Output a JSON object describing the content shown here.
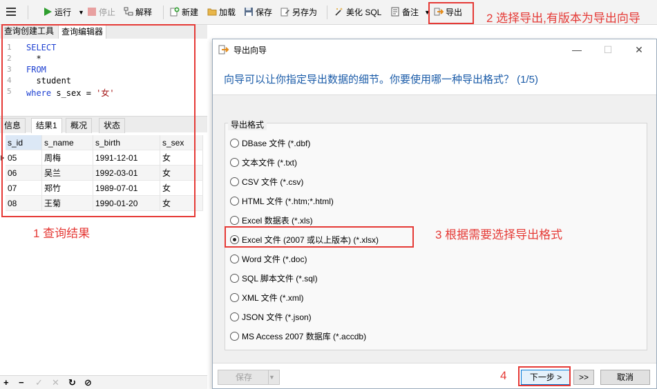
{
  "toolbar": {
    "menu_icon": "hamburger-icon",
    "run": "运行",
    "stop": "停止",
    "explain": "解释",
    "new": "新建",
    "load": "加载",
    "save": "保存",
    "save_as": "另存为",
    "beautify": "美化 SQL",
    "comment": "备注",
    "export": "导出"
  },
  "left_tabs": [
    "查询创建工具",
    "查询编辑器"
  ],
  "editor": {
    "lines": [
      {
        "no": "1",
        "text": "SELECT"
      },
      {
        "no": "2",
        "text": "  *"
      },
      {
        "no": "3",
        "text": "FROM"
      },
      {
        "no": "4",
        "text": "  student"
      },
      {
        "no": "5",
        "text": "where s_sex = '女'"
      }
    ]
  },
  "result_tabs": [
    "信息",
    "结果1",
    "概况",
    "状态"
  ],
  "grid": {
    "columns": [
      "s_id",
      "s_name",
      "s_birth",
      "s_sex"
    ],
    "rows": [
      [
        "05",
        "周梅",
        "1991-12-01",
        "女"
      ],
      [
        "06",
        "吴兰",
        "1992-03-01",
        "女"
      ],
      [
        "07",
        "郑竹",
        "1989-07-01",
        "女"
      ],
      [
        "08",
        "王菊",
        "1990-01-20",
        "女"
      ]
    ]
  },
  "annotations": {
    "a1": "1 查询结果",
    "a2": "2 选择导出,有版本为导出向导",
    "a3": "3 根据需要选择导出格式",
    "a4": "4"
  },
  "dialog": {
    "title": "导出向导",
    "heading": "向导可以让你指定导出数据的细节。你要使用哪一种导出格式？ (1/5)",
    "group_label": "导出格式",
    "options": [
      "DBase 文件 (*.dbf)",
      "文本文件 (*.txt)",
      "CSV 文件 (*.csv)",
      "HTML 文件 (*.htm;*.html)",
      "Excel 数据表 (*.xls)",
      "Excel 文件 (2007 或以上版本) (*.xlsx)",
      "Word 文件 (*.doc)",
      "SQL 脚本文件 (*.sql)",
      "XML 文件 (*.xml)",
      "JSON 文件 (*.json)",
      "MS Access 2007 数据库 (*.accdb)"
    ],
    "selected_option": "Excel 文件 (2007 或以上版本) (*.xlsx)",
    "buttons": {
      "save": "保存",
      "next": "下一步 >",
      "last": ">>",
      "cancel": "取消"
    }
  },
  "colors": {
    "annotation_red": "#e53935",
    "heading_blue": "#1a5ba8",
    "run_green": "#2e9e2e",
    "keyword_blue": "#1c3fd1"
  }
}
